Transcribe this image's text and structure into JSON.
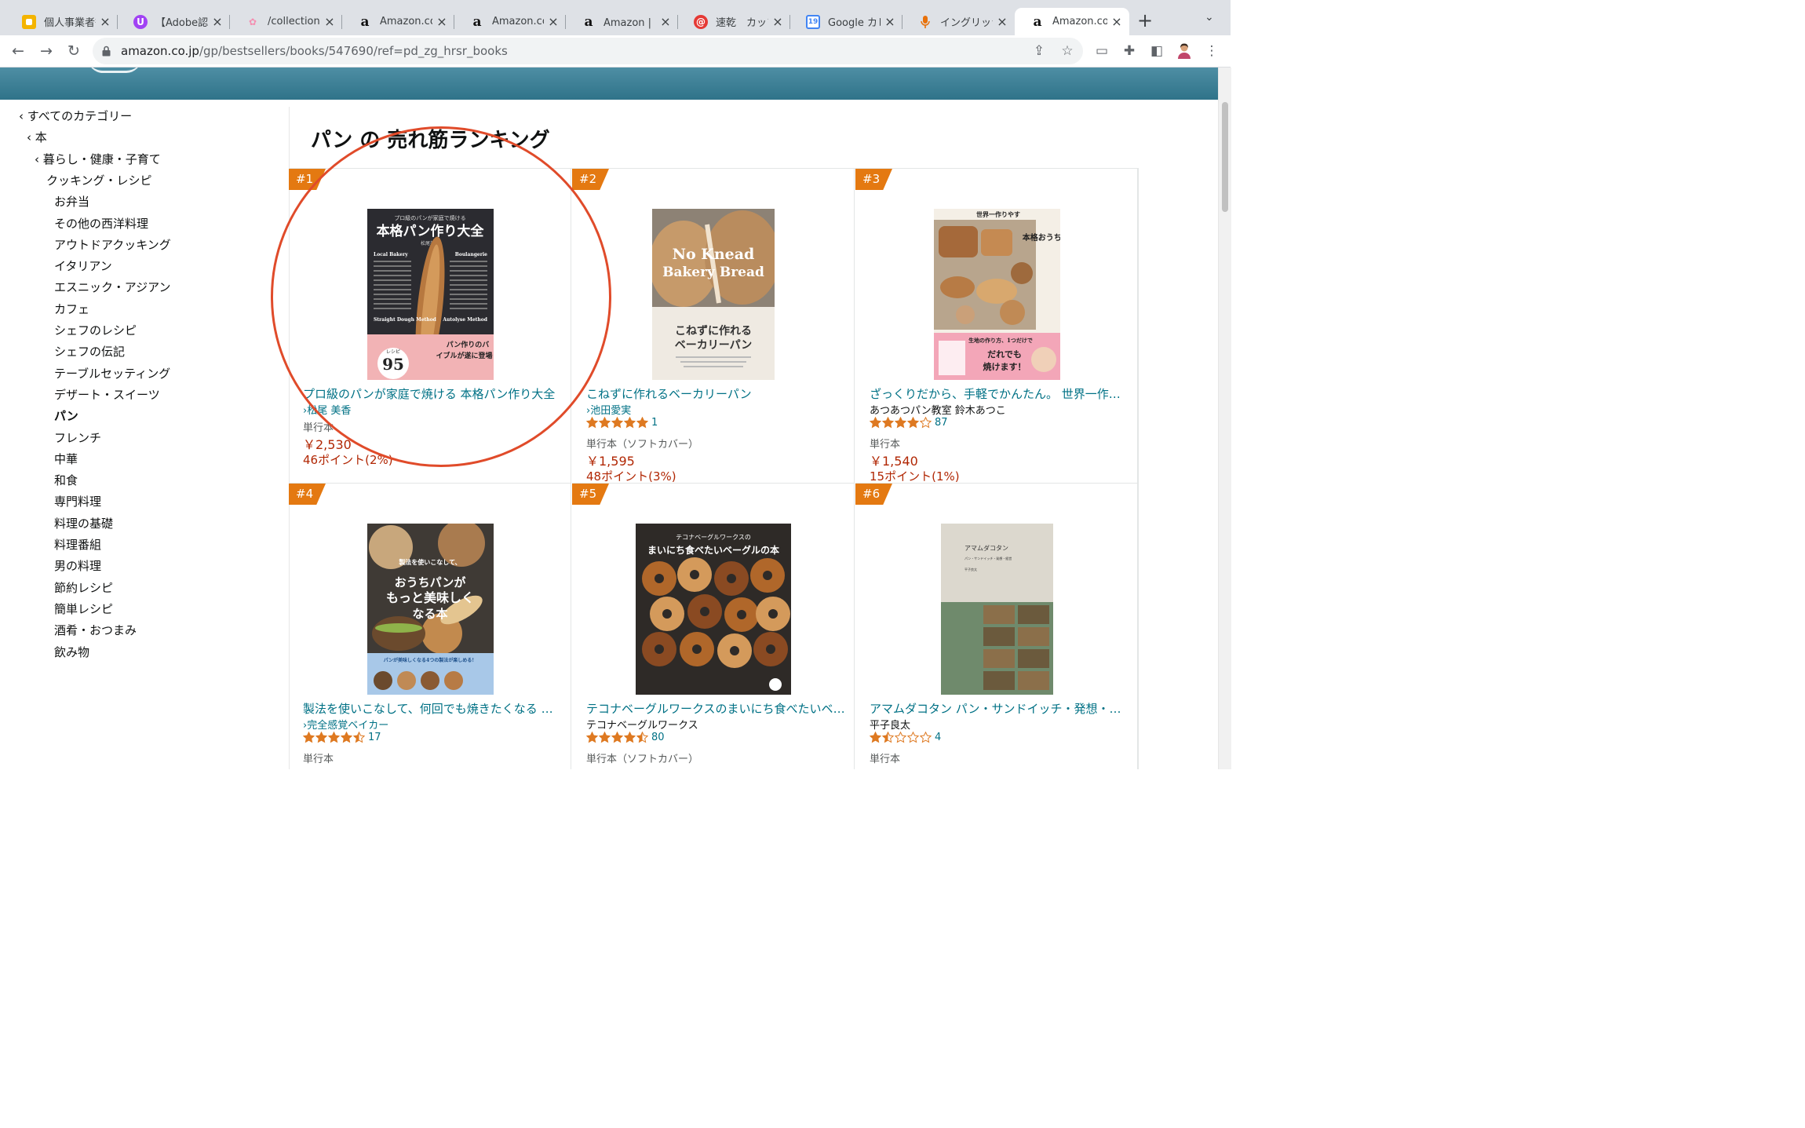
{
  "browser": {
    "tabs": [
      {
        "title": "個人事業者等",
        "favicon": "blogger-icon",
        "color": "#f4b400"
      },
      {
        "title": "【Adobe認定",
        "favicon": "u-badge-icon",
        "color": "#a142f4"
      },
      {
        "title": "/collections",
        "favicon": "flower-icon",
        "color": "#f48fb1"
      },
      {
        "title": "Amazon.co.",
        "favicon": "amazon-icon",
        "color": "#ffffff"
      },
      {
        "title": "Amazon.co.",
        "favicon": "amazon-icon",
        "color": "#ffffff"
      },
      {
        "title": "Amazon | 【",
        "favicon": "amazon-icon",
        "color": "#ffffff"
      },
      {
        "title": "速乾　カップ",
        "favicon": "at-icon",
        "color": "#e53935"
      },
      {
        "title": "Google カレ",
        "favicon": "calendar-icon",
        "color": "#4285f4"
      },
      {
        "title": "イングリッシ",
        "favicon": "microphone-icon",
        "color": "#e8710a"
      },
      {
        "title": "Amazon.co.",
        "favicon": "amazon-icon",
        "color": "#ffffff"
      }
    ],
    "calendar_day": "19",
    "url_domain": "amazon.co.jp",
    "url_path": "/gp/bestsellers/books/547690/ref=pd_zg_hrsr_books"
  },
  "sidebar": {
    "items": [
      {
        "label": "‹ すべてのカテゴリー",
        "bold": false
      },
      {
        "label": "‹ 本",
        "bold": false
      },
      {
        "label": "‹ 暮らし・健康・子育て",
        "bold": false
      },
      {
        "label": "クッキング・レシピ",
        "bold": false
      },
      {
        "label": "お弁当",
        "bold": false
      },
      {
        "label": "その他の西洋料理",
        "bold": false
      },
      {
        "label": "アウトドアクッキング",
        "bold": false
      },
      {
        "label": "イタリアン",
        "bold": false
      },
      {
        "label": "エスニック・アジアン",
        "bold": false
      },
      {
        "label": "カフェ",
        "bold": false
      },
      {
        "label": "シェフのレシピ",
        "bold": false
      },
      {
        "label": "シェフの伝記",
        "bold": false
      },
      {
        "label": "テーブルセッティング",
        "bold": false
      },
      {
        "label": "デザート・スイーツ",
        "bold": false
      },
      {
        "label": "パン",
        "bold": true
      },
      {
        "label": "フレンチ",
        "bold": false
      },
      {
        "label": "中華",
        "bold": false
      },
      {
        "label": "和食",
        "bold": false
      },
      {
        "label": "専門料理",
        "bold": false
      },
      {
        "label": "料理の基礎",
        "bold": false
      },
      {
        "label": "料理番組",
        "bold": false
      },
      {
        "label": "男の料理",
        "bold": false
      },
      {
        "label": "節約レシピ",
        "bold": false
      },
      {
        "label": "簡単レシピ",
        "bold": false
      },
      {
        "label": "酒肴・おつまみ",
        "bold": false
      },
      {
        "label": "飲み物",
        "bold": false
      }
    ]
  },
  "main": {
    "heading": "パン の 売れ筋ランキング",
    "products": [
      {
        "rank": "#1",
        "title": "プロ級のパンが家庭で焼ける 本格パン作り大全",
        "author": "›松尾 美香",
        "author_link": true,
        "stars": null,
        "reviews": "",
        "format": "単行本",
        "price": "￥2,530",
        "points": "46ポイント(2%)",
        "cover": {
          "bg": "#2b2b30",
          "accent": "#f2b3b5",
          "lines": [
            "プロ級のパンが家庭で焼ける",
            "本格パン作り大全",
            "松尾美香",
            "Local Bakery",
            "Boulangerie",
            "Straight Dough Method",
            "Autolyse Method",
            "95",
            "レシピ",
            "パン作りのバイブルが遂に登場！"
          ]
        }
      },
      {
        "rank": "#2",
        "title": "こねずに作れるベーカリーパン",
        "author": "›池田愛実",
        "author_link": true,
        "stars": 5,
        "reviews": "1",
        "format": "単行本（ソフトカバー）",
        "price": "￥1,595",
        "points": "48ポイント(3%)",
        "cover": {
          "bg": "#8d8275",
          "accent": "#ffffff",
          "lines": [
            "No Knead",
            "Bakery Bread",
            "こねずに作れる",
            "ベーカリーパン",
            "池田愛実"
          ]
        }
      },
      {
        "rank": "#3",
        "title": "ざっくりだから、手軽でかんたん。 世界一作りやすい本格おうちパン",
        "author": "あつあつパン教室 鈴木あつこ",
        "author_link": false,
        "stars": 4,
        "reviews": "87",
        "format": "単行本",
        "price": "￥1,540",
        "points": "15ポイント(1%)",
        "cover": {
          "bg": "#b8a58d",
          "accent": "#f3a6b8",
          "lines": [
            "世界一作りやすい本格おうちパン",
            "生地の作り方、1つだけで",
            "だれでも",
            "焼けます！"
          ]
        }
      },
      {
        "rank": "#4",
        "title": "製法を使いこなして、何回でも焼きたくなる おうちパンがもっと美味しくなる本",
        "author": "›完全感覚ベイカー",
        "author_link": true,
        "stars": 4.5,
        "reviews": "17",
        "format": "単行本",
        "price": "",
        "points": "",
        "cover": {
          "bg": "#3f3a35",
          "accent": "#a8c8e8",
          "lines": [
            "製法を使いこなして、",
            "おうちパンが",
            "もっと美味しく",
            "なる本",
            "パンが美味しくなる4つの製法が楽しめる！"
          ]
        }
      },
      {
        "rank": "#5",
        "title": "テコナベーグルワークスのまいにち食べたいベーグルの本",
        "author": "テコナベーグルワークス",
        "author_link": false,
        "stars": 4.5,
        "reviews": "80",
        "format": "単行本（ソフトカバー）",
        "price": "",
        "points": "",
        "cover": {
          "bg": "#2e2a27",
          "accent": "#c9893f",
          "lines": [
            "テコナベーグルワークスの",
            "まいにち食べたいベーグルの本"
          ]
        }
      },
      {
        "rank": "#6",
        "title": "アマムダコタン パン・サンドイッチ・発想・経営",
        "author": "平子良太",
        "author_link": false,
        "stars": 1.5,
        "reviews": "4",
        "format": "単行本",
        "price": "",
        "points": "",
        "cover": {
          "bg": "#dcd8ce",
          "accent": "#6f8a6c",
          "lines": [
            "アマムダコタン",
            "パン・サンドイッチ・発想・経営",
            "平子良太"
          ]
        }
      }
    ]
  },
  "colors": {
    "brand_banner": "#3f8196",
    "rank_badge": "#e47911",
    "link": "#007185",
    "price": "#b12704",
    "annotation": "#e04b2a",
    "star": "#de7921"
  }
}
